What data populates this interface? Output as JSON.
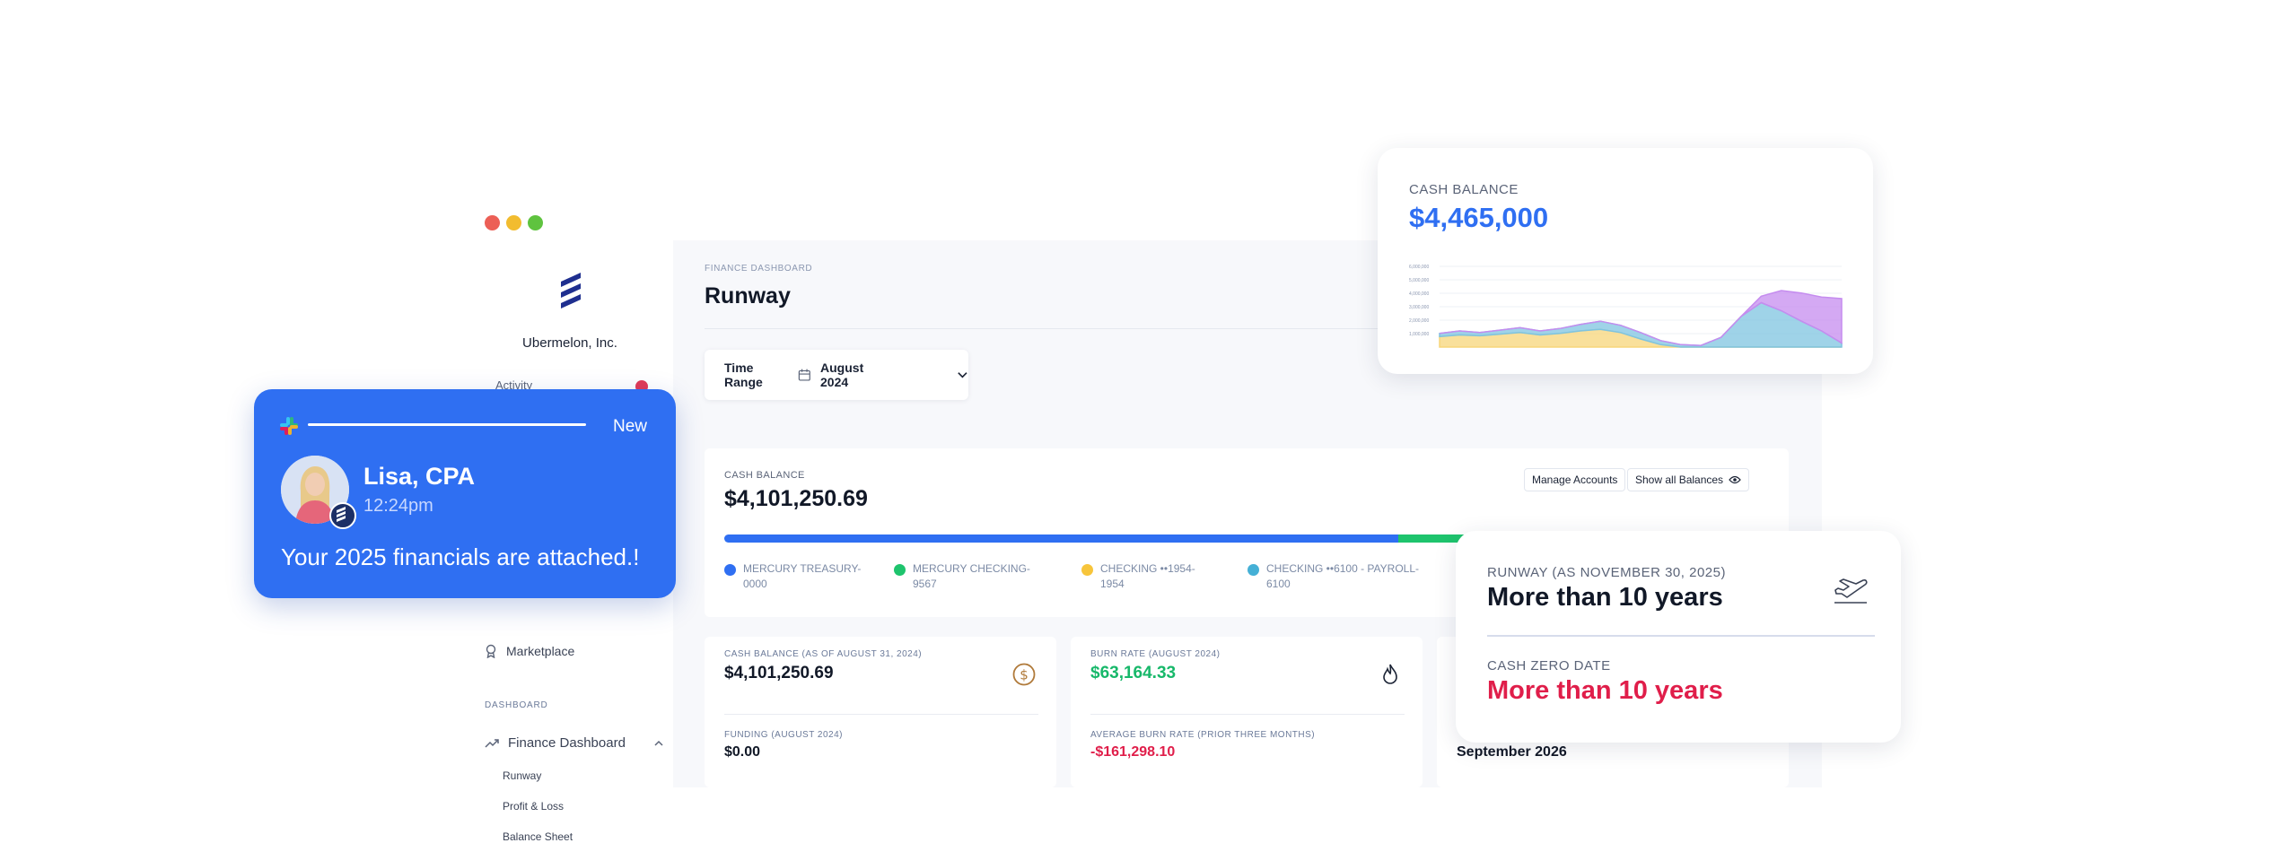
{
  "sidebar": {
    "company_name": "Ubermelon, Inc.",
    "partially_hidden_item": "Activity",
    "marketplace_label": "Marketplace",
    "section_label": "DASHBOARD",
    "finance_dashboard_label": "Finance Dashboard",
    "sub_items": [
      "Runway",
      "Profit & Loss",
      "Balance Sheet"
    ]
  },
  "main": {
    "breadcrumb": "FINANCE DASHBOARD",
    "title": "Runway",
    "time_range": {
      "label": "Time Range",
      "value": "August 2024"
    },
    "balance_card": {
      "label": "CASH BALANCE",
      "amount": "$4,101,250.69",
      "manage_accounts": "Manage Accounts",
      "show_all_balances": "Show all Balances",
      "bar_segments": [
        {
          "share": 0.645,
          "color": "#2f6ff2"
        },
        {
          "share": 0.1,
          "color": "#1ec46d"
        },
        {
          "share": 0.062,
          "color": "#f7c53b"
        },
        {
          "share": 0.1,
          "color": "#45b0d6"
        },
        {
          "share": 0.093,
          "color": "#a26cf0"
        }
      ],
      "legend": [
        {
          "line1": "MERCURY TREASURY-",
          "line2": "0000",
          "color": "#2f6ff2"
        },
        {
          "line1": "MERCURY CHECKING-",
          "line2": "9567",
          "color": "#1ec46d"
        },
        {
          "line1": "CHECKING ••1954-",
          "line2": "1954",
          "color": "#f7c53b"
        },
        {
          "line1": "CHECKING ••6100 - PAYROLL-",
          "line2": "6100",
          "color": "#45b0d6"
        }
      ]
    },
    "metrics": [
      {
        "label1": "CASH BALANCE (AS OF AUGUST 31, 2024)",
        "value1": "$4,101,250.69",
        "value1_color": "#111827",
        "label2": "FUNDING (AUGUST 2024)",
        "value2": "$0.00",
        "value2_color": "#111827",
        "icon": "dollar-coin-icon"
      },
      {
        "label1": "BURN RATE (AUGUST 2024)",
        "value1": "$63,164.33",
        "value1_color": "#17b86a",
        "label2": "AVERAGE BURN RATE (PRIOR THREE MONTHS)",
        "value2": "-$161,298.10",
        "value2_color": "#e01e4a",
        "icon": "flame-icon"
      },
      {
        "label1": "",
        "value1": "",
        "value1_color": "#111827",
        "label2": "",
        "value2": "September 2026",
        "value2_color": "#111827",
        "icon": ""
      }
    ]
  },
  "notification": {
    "badge": "New",
    "sender": "Lisa, CPA",
    "time": "12:24pm",
    "message": "Your 2025 financials are attached.!",
    "icon": "slack-logo-icon"
  },
  "cash_float": {
    "label": "CASH BALANCE",
    "amount": "$4,465,000",
    "y_ticks": [
      "6,000,000",
      "5,000,000",
      "4,000,000",
      "3,000,000",
      "2,000,000",
      "1,000,000"
    ],
    "chart_data": {
      "type": "area",
      "series": [
        {
          "values": [
            0.13,
            0.15,
            0.14,
            0.16,
            0.18,
            0.15,
            0.17,
            0.2,
            0.22,
            0.18,
            0.1,
            0.03,
            0.0,
            0.0,
            0.0,
            0.0,
            0.0,
            0.0,
            0.0,
            0.0,
            0.0
          ],
          "color": "#f7d57a"
        },
        {
          "values": [
            0.04,
            0.05,
            0.04,
            0.05,
            0.06,
            0.05,
            0.06,
            0.08,
            0.1,
            0.09,
            0.08,
            0.05,
            0.03,
            0.02,
            0.12,
            0.38,
            0.55,
            0.45,
            0.32,
            0.2,
            0.05
          ],
          "color": "#7fc4e0"
        },
        {
          "values": [
            0.0,
            0.0,
            0.0,
            0.0,
            0.0,
            0.0,
            0.0,
            0.0,
            0.0,
            0.0,
            0.0,
            0.0,
            0.0,
            0.0,
            0.0,
            0.0,
            0.08,
            0.25,
            0.35,
            0.42,
            0.55
          ],
          "color": "#c58cef"
        }
      ]
    }
  },
  "runway_float": {
    "label": "RUNWAY (AS NOVEMBER 30, 2025)",
    "value": "More than 10 years",
    "zero_label": "CASH ZERO DATE",
    "zero_value": "More than 10 years"
  },
  "colors": {
    "accent": "#2f6ff2",
    "danger": "#e01e4a",
    "success": "#17b86a"
  }
}
